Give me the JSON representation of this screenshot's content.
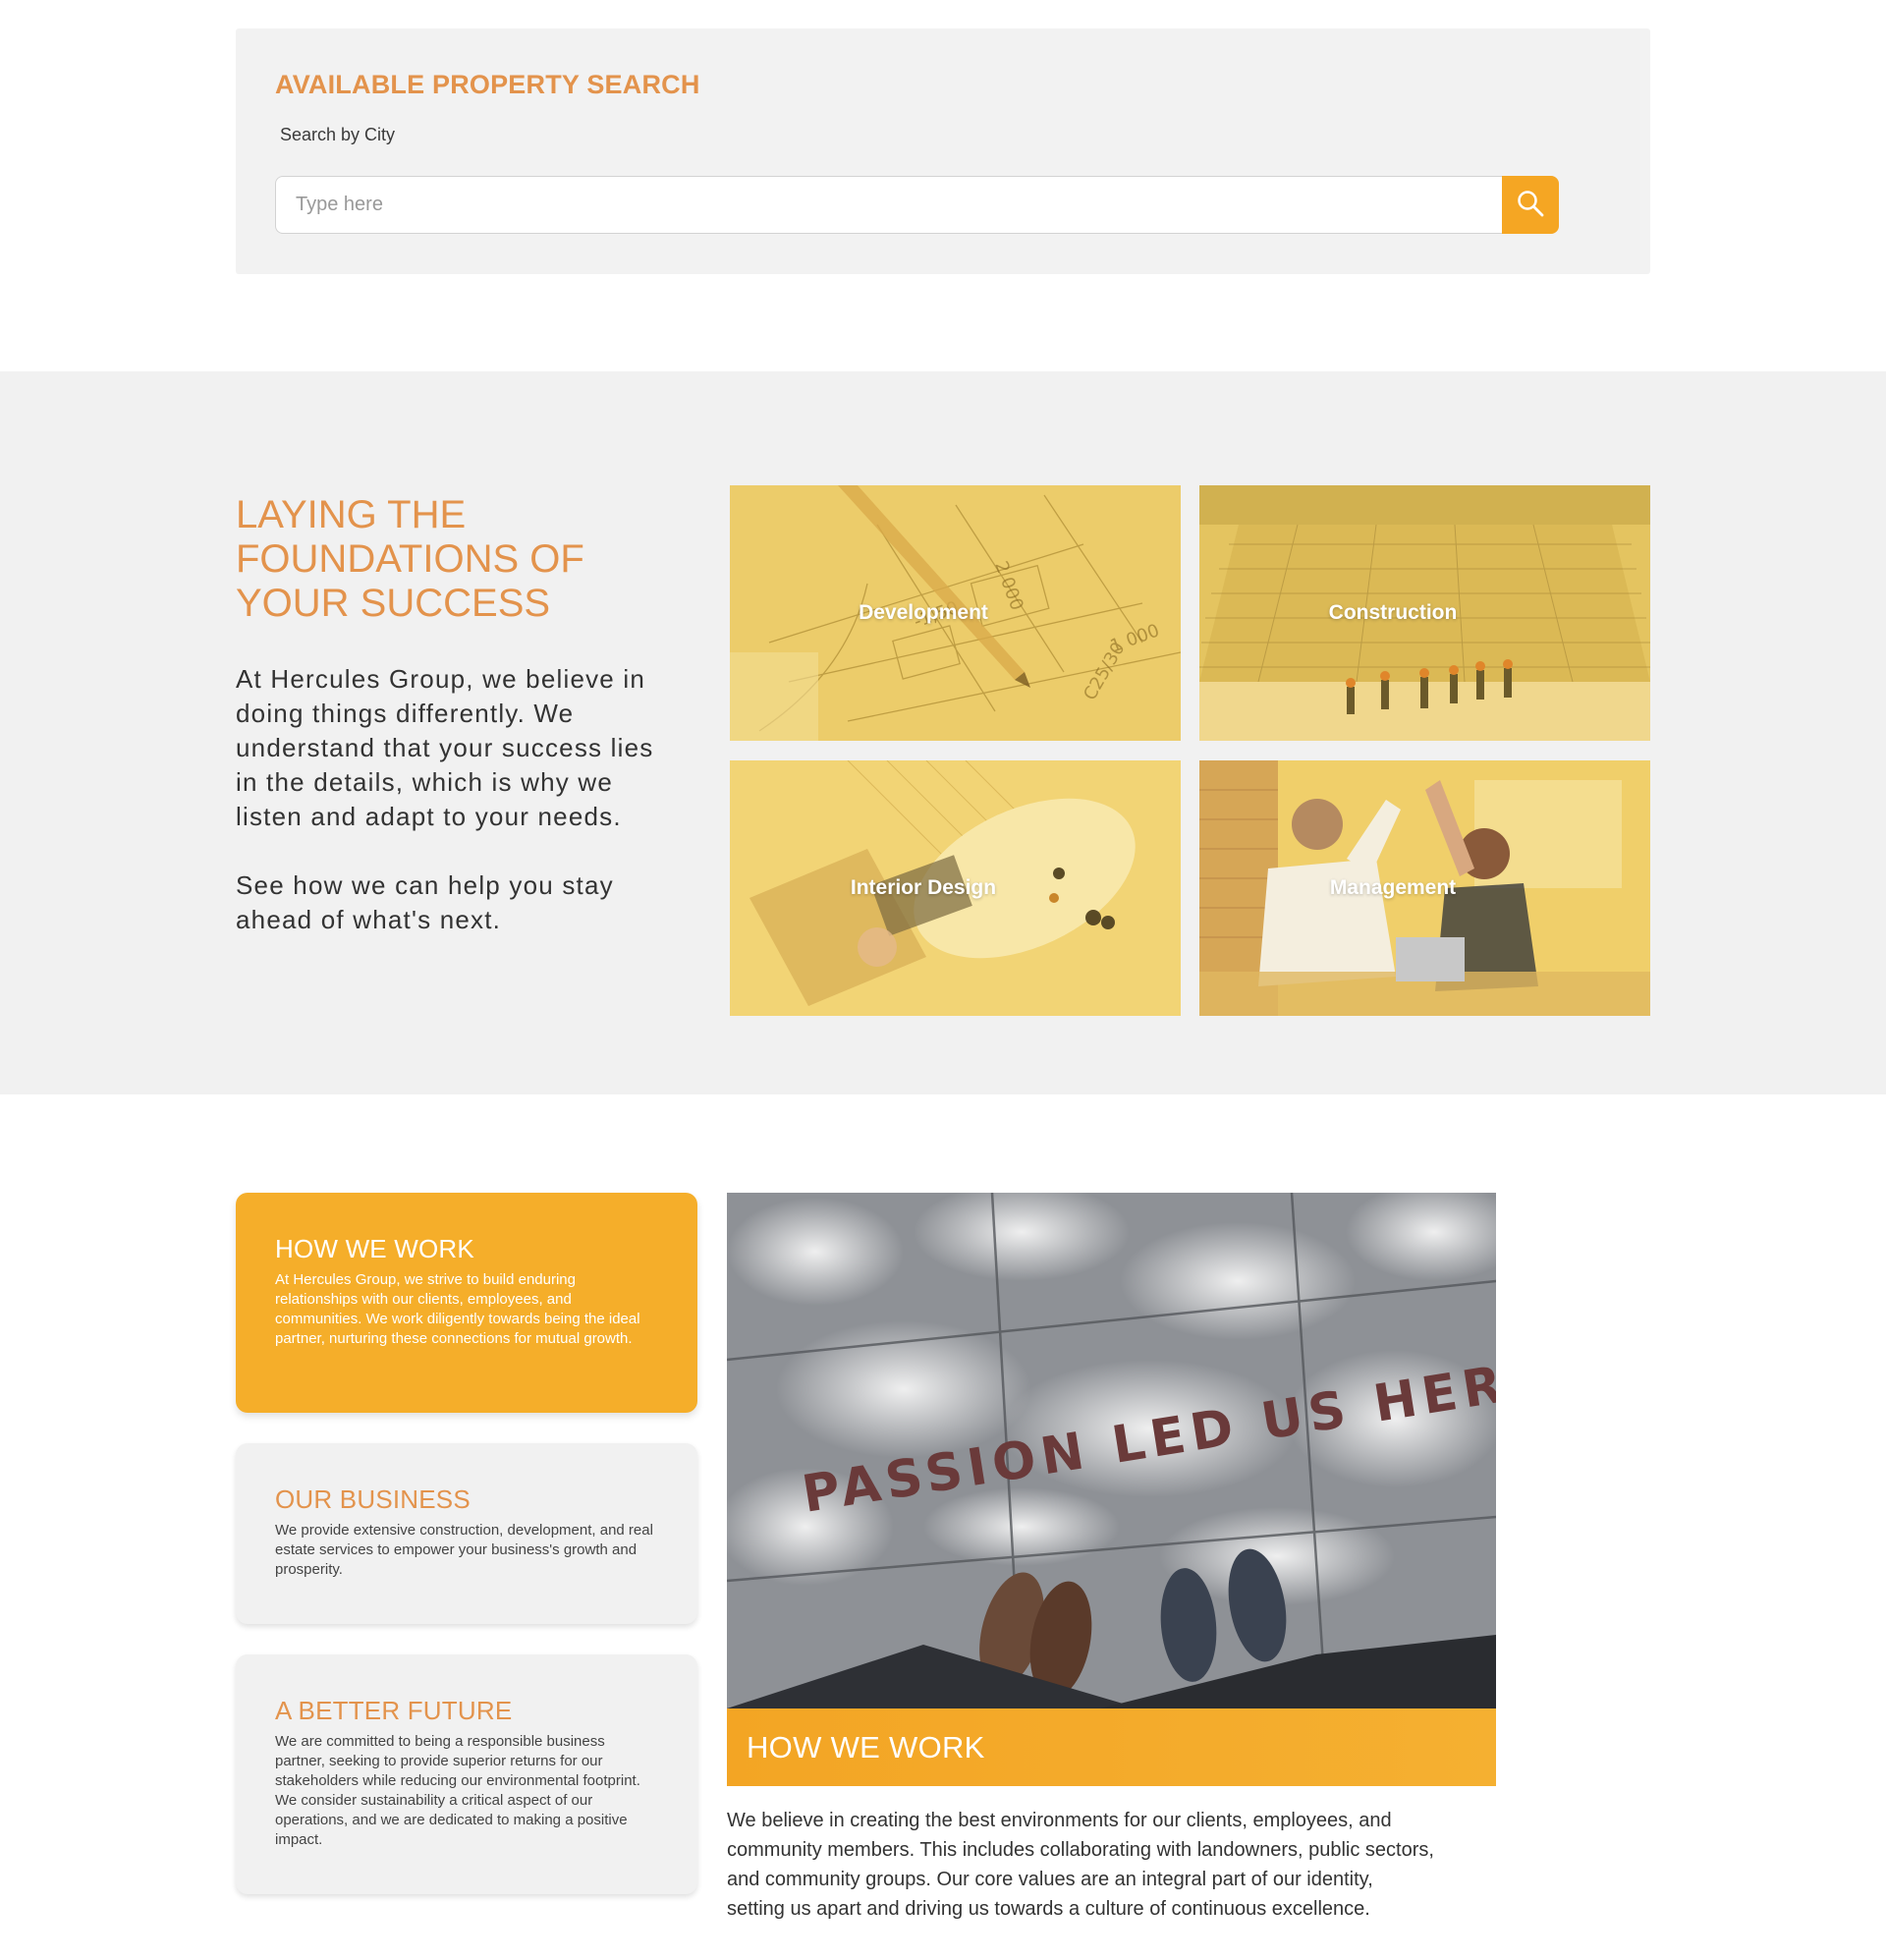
{
  "search": {
    "title": "AVAILABLE PROPERTY SEARCH",
    "label": "Search by City",
    "placeholder": "Type here",
    "value": "",
    "button_icon": "search-icon"
  },
  "foundations": {
    "heading": "LAYING THE FOUNDATIONS OF YOUR SUCCESS",
    "paragraph1": "At Hercules Group, we believe in doing things differently. We understand that your success lies in the details, which is why we listen and adapt to your needs.",
    "paragraph2": "See how we can help you stay ahead of what's next.",
    "tiles": [
      {
        "label": "Development"
      },
      {
        "label": "Construction"
      },
      {
        "label": "Interior Design"
      },
      {
        "label": "Management"
      }
    ]
  },
  "cards": [
    {
      "title": "HOW WE WORK",
      "text": "At Hercules Group, we strive to build enduring relationships with our clients, employees, and communities. We work diligently towards being the ideal partner, nurturing these connections for mutual growth."
    },
    {
      "title": "OUR BUSINESS",
      "text": "We provide extensive construction, development, and real estate services to empower your business's growth and prosperity."
    },
    {
      "title": "A BETTER FUTURE",
      "text": "We are committed to being a responsible business partner, seeking to provide superior returns for our stakeholders while reducing our environmental footprint. We consider sustainability a critical aspect of our operations, and we are dedicated to making a positive impact."
    }
  ],
  "feature": {
    "image_text": "PASSION LED US HERE",
    "banner_title": "HOW WE WORK",
    "text": "We believe in creating the best environments for our clients, employees, and community members. This includes collaborating with landowners, public sectors, and community groups. Our core values are an integral part of our identity, setting us apart and driving us towards a culture of continuous excellence."
  },
  "colors": {
    "accent": "#f5a623",
    "heading": "#e3934c",
    "panel_bg": "#f1f1f1",
    "tile_overlay": "#f3c94a"
  }
}
